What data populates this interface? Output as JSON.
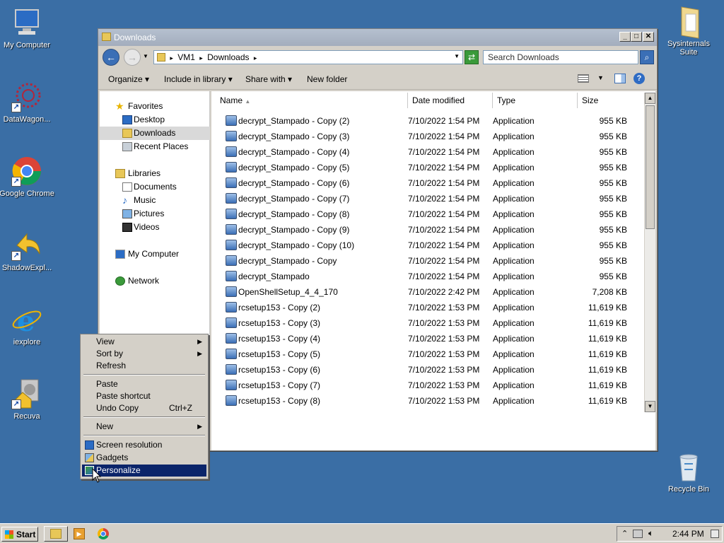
{
  "desktop": {
    "icons": [
      {
        "label": "My Computer"
      },
      {
        "label": "DataWagon..."
      },
      {
        "label": "Google Chrome"
      },
      {
        "label": "ShadowExpl..."
      },
      {
        "label": "iexplore"
      },
      {
        "label": "Recuva"
      },
      {
        "label": "Sysinternals Suite"
      },
      {
        "label": "Recycle Bin"
      }
    ]
  },
  "window": {
    "title": "Downloads",
    "buttons": {
      "minimize": "_",
      "maximize": "□",
      "close": "✕"
    },
    "address": {
      "segments": [
        "VM1",
        "Downloads"
      ],
      "separator": "▸"
    },
    "search": {
      "placeholder": "Search Downloads"
    },
    "toolbar": {
      "organize": "Organize",
      "include": "Include in library",
      "share": "Share with",
      "newfolder": "New folder"
    },
    "nav": {
      "favorites": "Favorites",
      "desktop": "Desktop",
      "downloads": "Downloads",
      "recent": "Recent Places",
      "libraries": "Libraries",
      "documents": "Documents",
      "music": "Music",
      "pictures": "Pictures",
      "videos": "Videos",
      "mycomputer": "My Computer",
      "network": "Network"
    },
    "columns": {
      "name": "Name",
      "date": "Date modified",
      "type": "Type",
      "size": "Size"
    },
    "files": [
      {
        "name": "decrypt_Stampado - Copy (2)",
        "date": "7/10/2022 1:54 PM",
        "type": "Application",
        "size": "955 KB"
      },
      {
        "name": "decrypt_Stampado - Copy (3)",
        "date": "7/10/2022 1:54 PM",
        "type": "Application",
        "size": "955 KB"
      },
      {
        "name": "decrypt_Stampado - Copy (4)",
        "date": "7/10/2022 1:54 PM",
        "type": "Application",
        "size": "955 KB"
      },
      {
        "name": "decrypt_Stampado - Copy (5)",
        "date": "7/10/2022 1:54 PM",
        "type": "Application",
        "size": "955 KB"
      },
      {
        "name": "decrypt_Stampado - Copy (6)",
        "date": "7/10/2022 1:54 PM",
        "type": "Application",
        "size": "955 KB"
      },
      {
        "name": "decrypt_Stampado - Copy (7)",
        "date": "7/10/2022 1:54 PM",
        "type": "Application",
        "size": "955 KB"
      },
      {
        "name": "decrypt_Stampado - Copy (8)",
        "date": "7/10/2022 1:54 PM",
        "type": "Application",
        "size": "955 KB"
      },
      {
        "name": "decrypt_Stampado - Copy (9)",
        "date": "7/10/2022 1:54 PM",
        "type": "Application",
        "size": "955 KB"
      },
      {
        "name": "decrypt_Stampado - Copy (10)",
        "date": "7/10/2022 1:54 PM",
        "type": "Application",
        "size": "955 KB"
      },
      {
        "name": "decrypt_Stampado - Copy",
        "date": "7/10/2022 1:54 PM",
        "type": "Application",
        "size": "955 KB"
      },
      {
        "name": "decrypt_Stampado",
        "date": "7/10/2022 1:54 PM",
        "type": "Application",
        "size": "955 KB"
      },
      {
        "name": "OpenShellSetup_4_4_170",
        "date": "7/10/2022 2:42 PM",
        "type": "Application",
        "size": "7,208 KB"
      },
      {
        "name": "rcsetup153 - Copy (2)",
        "date": "7/10/2022 1:53 PM",
        "type": "Application",
        "size": "11,619 KB"
      },
      {
        "name": "rcsetup153 - Copy (3)",
        "date": "7/10/2022 1:53 PM",
        "type": "Application",
        "size": "11,619 KB"
      },
      {
        "name": "rcsetup153 - Copy (4)",
        "date": "7/10/2022 1:53 PM",
        "type": "Application",
        "size": "11,619 KB"
      },
      {
        "name": "rcsetup153 - Copy (5)",
        "date": "7/10/2022 1:53 PM",
        "type": "Application",
        "size": "11,619 KB"
      },
      {
        "name": "rcsetup153 - Copy (6)",
        "date": "7/10/2022 1:53 PM",
        "type": "Application",
        "size": "11,619 KB"
      },
      {
        "name": "rcsetup153 - Copy (7)",
        "date": "7/10/2022 1:53 PM",
        "type": "Application",
        "size": "11,619 KB"
      },
      {
        "name": "rcsetup153 - Copy (8)",
        "date": "7/10/2022 1:53 PM",
        "type": "Application",
        "size": "11,619 KB"
      }
    ]
  },
  "context_menu": {
    "view": "View",
    "sortby": "Sort by",
    "refresh": "Refresh",
    "paste": "Paste",
    "paste_shortcut": "Paste shortcut",
    "undo_copy": "Undo Copy",
    "undo_shortcut": "Ctrl+Z",
    "new": "New",
    "screen_resolution": "Screen resolution",
    "gadgets": "Gadgets",
    "personalize": "Personalize"
  },
  "taskbar": {
    "start": "Start",
    "clock": "2:44 PM"
  },
  "colors": {
    "desktop": "#3a6ea5",
    "selection": "#0a246a",
    "chrome_face": "#d4d0c8"
  }
}
